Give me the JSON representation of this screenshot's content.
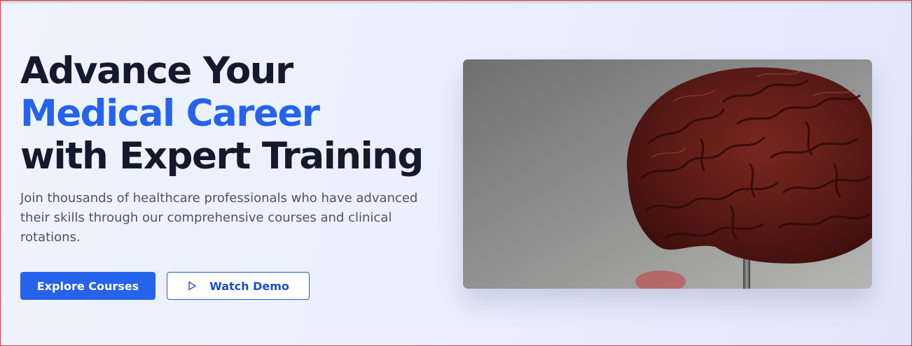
{
  "hero": {
    "headline_line1": "Advance Your",
    "headline_line2": "Medical Career",
    "headline_line3": "with Expert Training",
    "subtext": "Join thousands of healthcare professionals who have advanced their skills through our comprehensive courses and clinical rotations.",
    "primary_button_label": "Explore Courses",
    "secondary_button_label": "Watch Demo",
    "secondary_button_icon": "play-icon",
    "image_subject": "brain-model-image"
  },
  "colors": {
    "accent": "#2563eb",
    "heading": "#141a2e",
    "body_text": "#4b5364",
    "background": "#eaf0fd"
  }
}
